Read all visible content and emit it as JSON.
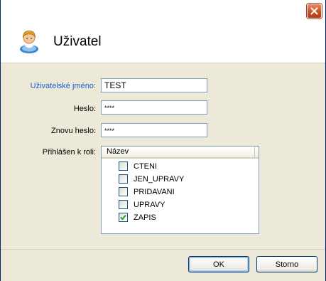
{
  "dialog": {
    "title": "Uživatel"
  },
  "form": {
    "username_label": "Uživatelské jméno:",
    "username_value": "TEST",
    "password_label": "Heslo:",
    "password_value": "****",
    "password_repeat_label": "Znovu heslo:",
    "password_repeat_value": "****",
    "roles_label": "Přihlášen k roli:"
  },
  "roles_list": {
    "column_header": "Název",
    "items": [
      {
        "name": "CTENI",
        "checked": false
      },
      {
        "name": "JEN_UPRAVY",
        "checked": false
      },
      {
        "name": "PRIDAVANI",
        "checked": false
      },
      {
        "name": "UPRAVY",
        "checked": false
      },
      {
        "name": "ZAPIS",
        "checked": true
      }
    ]
  },
  "buttons": {
    "ok_label": "OK",
    "cancel_label": "Storno"
  },
  "colors": {
    "accent_label": "#1c5fd1",
    "close_button": "#c94b20",
    "check_mark": "#21a121"
  },
  "icons": {
    "close": "close-icon",
    "user": "user-icon"
  }
}
